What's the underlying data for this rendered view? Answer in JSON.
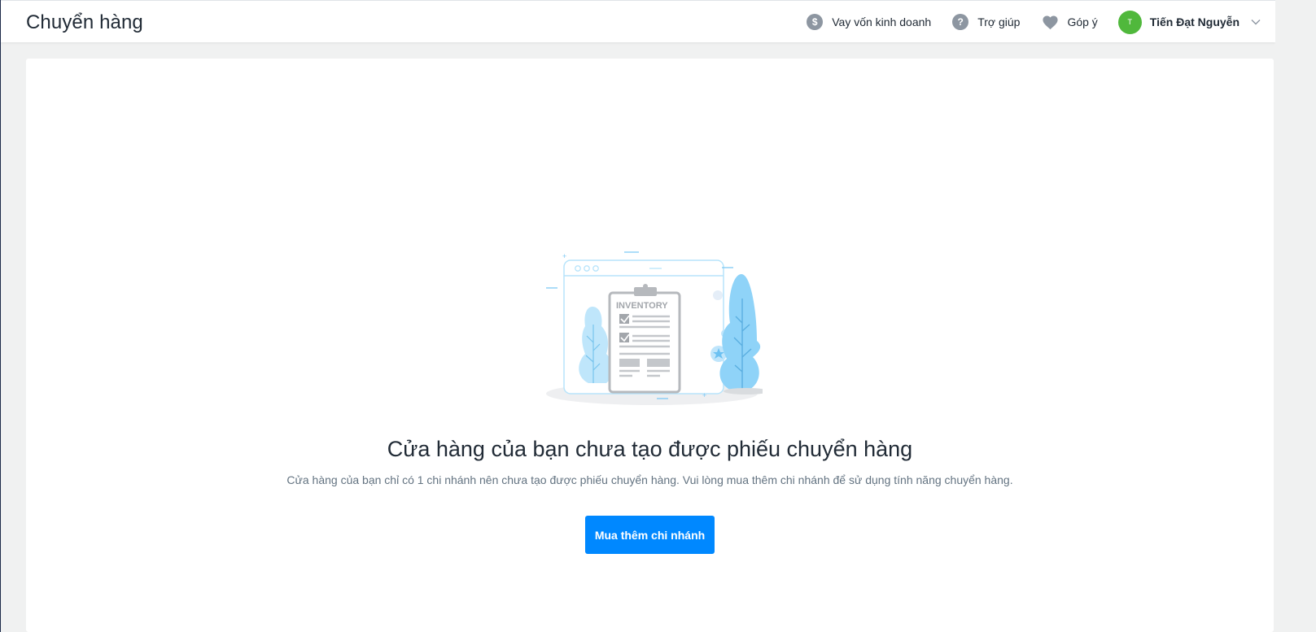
{
  "header": {
    "title": "Chuyển hàng",
    "nav": {
      "loan_label": "Vay vốn kinh doanh",
      "loan_icon": "dollar-icon",
      "help_label": "Trợ giúp",
      "help_icon": "help-icon",
      "feedback_label": "Góp ý",
      "feedback_icon": "heart-icon"
    },
    "user": {
      "avatar_initial": "T",
      "name": "Tiến Đạt Nguyễn",
      "avatar_color": "#50b83c"
    }
  },
  "empty_state": {
    "illustration_label": "INVENTORY",
    "title": "Cửa hàng của bạn chưa tạo được phiếu chuyển hàng",
    "description": "Cửa hàng của bạn chỉ có 1 chi nhánh nên chưa tạo được phiếu chuyển hàng. Vui lòng mua thêm chi nhánh để sử dụng tính năng chuyển hàng.",
    "button_label": "Mua thêm chi nhánh"
  },
  "colors": {
    "primary": "#0088ff",
    "background": "#f0f1f1",
    "illustration_blue": "#8fd3f8"
  }
}
